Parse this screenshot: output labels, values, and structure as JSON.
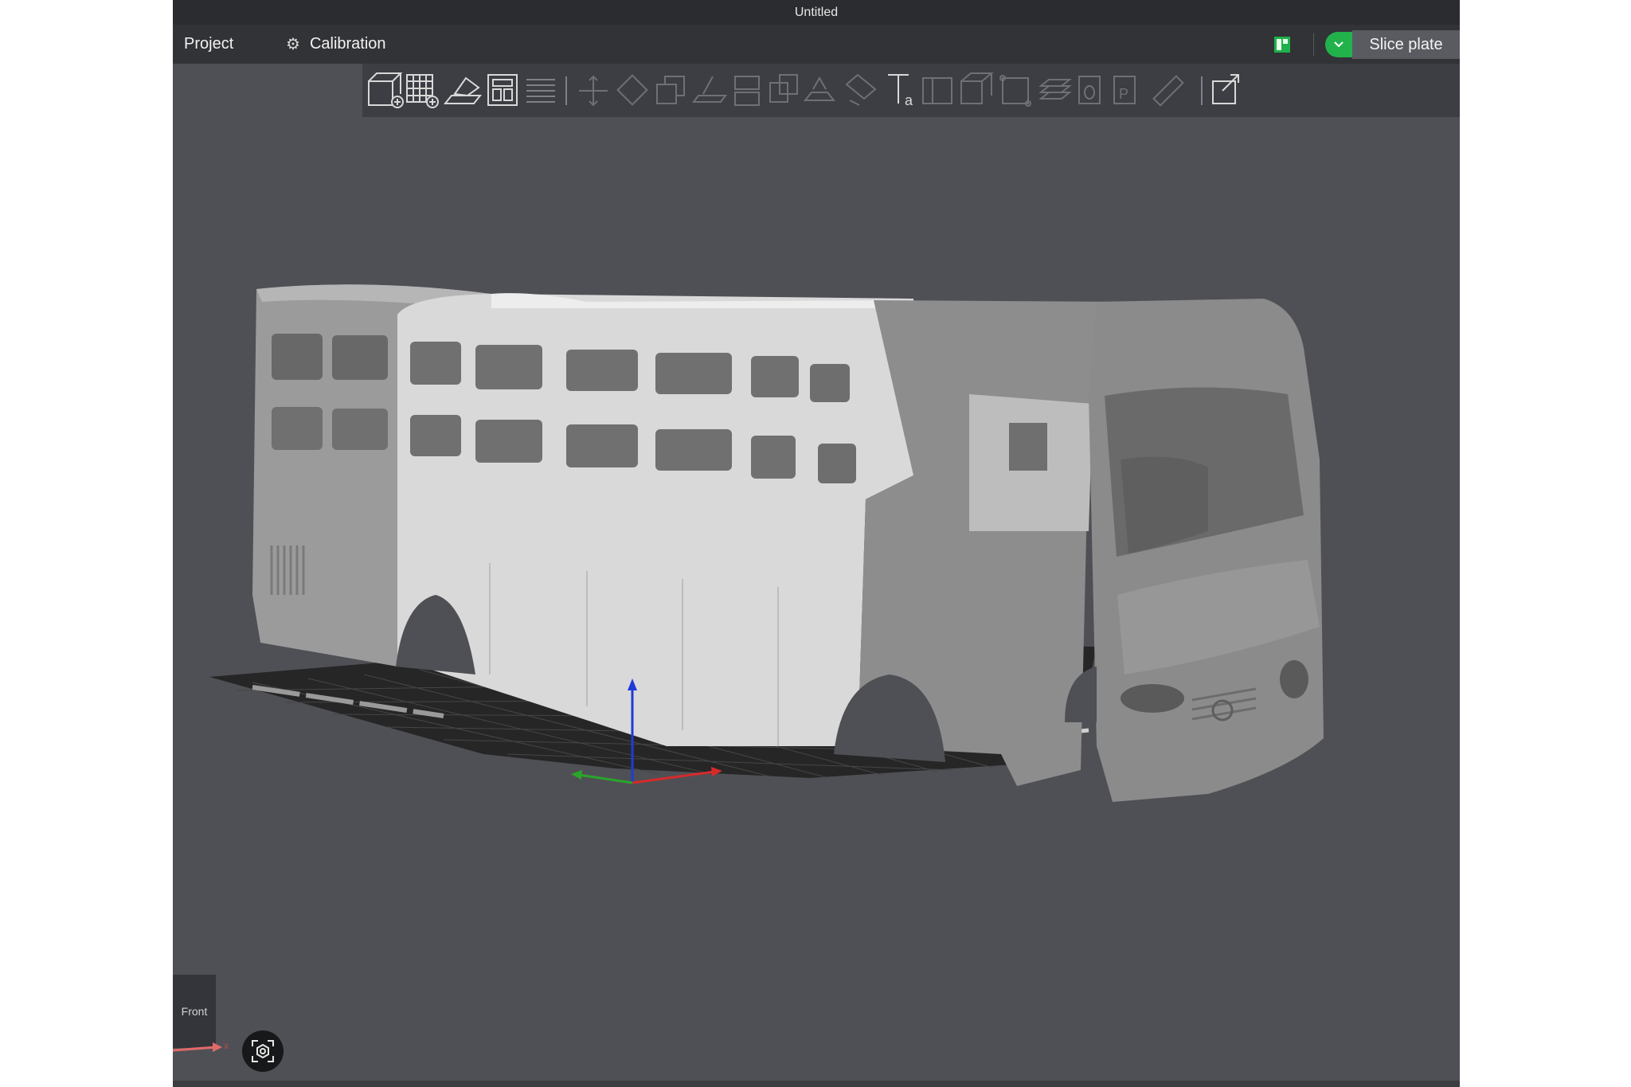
{
  "window": {
    "title": "Untitled"
  },
  "menubar": {
    "project_label": "Project",
    "calibration_label": "Calibration",
    "calibration_icon": "gear-icon",
    "layout_icon": "layout-panels-icon",
    "slice_toggle_icon": "chevron-down-icon",
    "slice_label": "Slice plate"
  },
  "toolbar": {
    "tools": [
      "add-object-icon",
      "add-plate-icon",
      "auto-orient-icon",
      "arrange-icon",
      "split-layers-icon",
      "move-icon",
      "rotate-icon",
      "scale-icon",
      "lay-on-face-icon",
      "cut-icon",
      "boolean-icon",
      "support-paint-icon",
      "seam-paint-icon",
      "text-icon",
      "assembly-icon",
      "view-cube-icon",
      "measure-frame-icon",
      "layers-icon",
      "object-o-icon",
      "object-p-icon",
      "ruler-icon",
      "export-icon"
    ]
  },
  "viewport": {
    "nav_cube_label": "Front",
    "axis_label": "x",
    "camera_icon": "camera-reset-icon",
    "colors": {
      "background": "#4f5055",
      "model_light": "#d9d9d9",
      "model_dark": "#8c8c8c",
      "plate": "#262626"
    }
  }
}
